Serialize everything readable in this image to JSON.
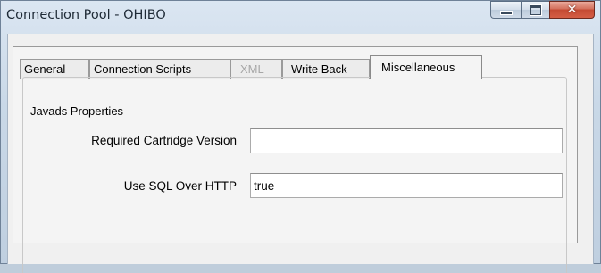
{
  "window": {
    "title": "Connection Pool - OHIBO",
    "controls": {
      "minimize": "minimize-icon",
      "maximize": "maximize-icon",
      "close": "close-icon"
    }
  },
  "tabs": [
    {
      "label": "General",
      "state": "normal"
    },
    {
      "label": "Connection Scripts",
      "state": "normal"
    },
    {
      "label": "XML",
      "state": "disabled"
    },
    {
      "label": "Write Back",
      "state": "normal"
    },
    {
      "label": "Miscellaneous",
      "state": "selected"
    }
  ],
  "group": {
    "title": "Javads Properties",
    "fields": [
      {
        "label": "Required Cartridge Version",
        "value": ""
      },
      {
        "label": "Use SQL Over HTTP",
        "value": "true"
      }
    ]
  }
}
